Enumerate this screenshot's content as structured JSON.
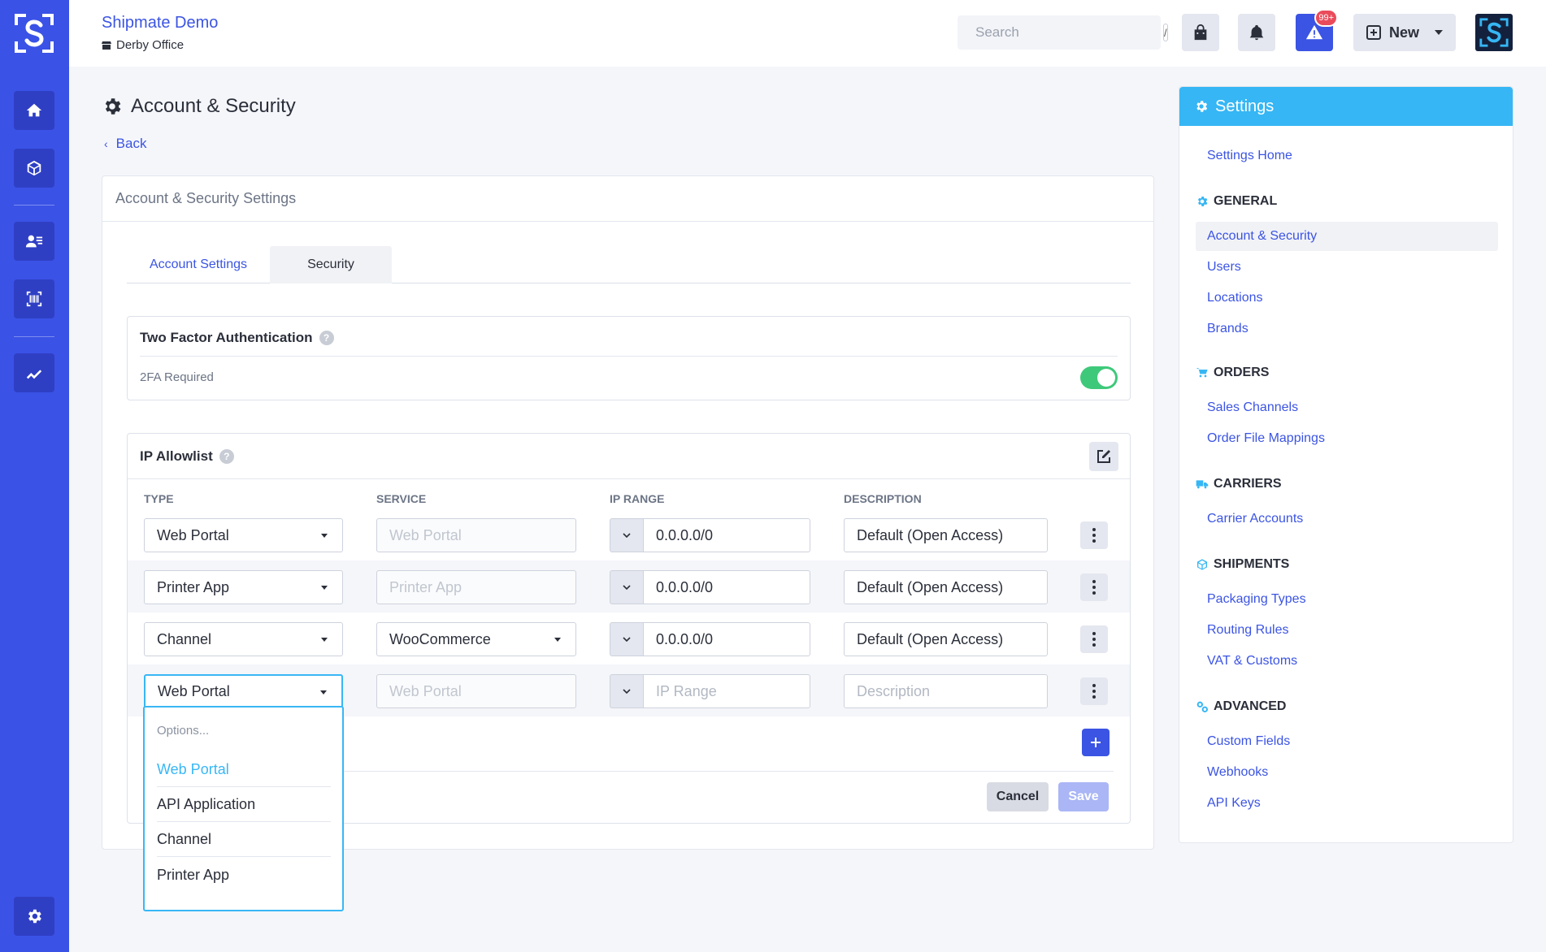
{
  "colors": {
    "brand": "#3a52e6",
    "accent": "#36b6f4",
    "toggle_on": "#3ec97a"
  },
  "sidebar": {
    "logo_icon": "shipmate-logo-icon",
    "items": [
      {
        "icon": "home-icon"
      },
      {
        "icon": "package-icon"
      },
      {
        "icon": "contacts-icon"
      },
      {
        "icon": "barcode-icon"
      },
      {
        "icon": "chart-line-icon"
      }
    ],
    "footer_icon": "gear-icon"
  },
  "topbar": {
    "org_name": "Shipmate Demo",
    "location": "Derby Office",
    "search_placeholder": "Search",
    "search_shortcut": "/",
    "alert_badge": "99+",
    "new_label": "New"
  },
  "page": {
    "title": "Account & Security",
    "back_label": "Back"
  },
  "card": {
    "header": "Account & Security Settings",
    "tabs": [
      {
        "label": "Account Settings"
      },
      {
        "label": "Security"
      }
    ],
    "two_factor": {
      "title": "Two Factor Authentication",
      "row_label": "2FA Required",
      "enabled": true
    },
    "ip_allowlist": {
      "title": "IP Allowlist",
      "columns": [
        "TYPE",
        "SERVICE",
        "IP RANGE",
        "DESCRIPTION"
      ],
      "rows": [
        {
          "type": "Web Portal",
          "service": "Web Portal",
          "ip_range": "0.0.0.0/0",
          "description": "Default (Open Access)"
        },
        {
          "type": "Printer App",
          "service": "Printer App",
          "ip_range": "0.0.0.0/0",
          "description": "Default (Open Access)"
        },
        {
          "type": "Channel",
          "service": "WooCommerce",
          "ip_range": "0.0.0.0/0",
          "description": "Default (Open Access)"
        },
        {
          "type": "Web Portal",
          "service": "Web Portal",
          "ip_range_placeholder": "IP Range",
          "description_placeholder": "Description"
        }
      ],
      "cancel_label": "Cancel",
      "save_label": "Save"
    },
    "dropdown": {
      "placeholder": "Options...",
      "options": [
        "Web Portal",
        "API Application",
        "Channel",
        "Printer App"
      ],
      "selected": "Web Portal"
    }
  },
  "settings_nav": {
    "title": "Settings",
    "home": "Settings Home",
    "sections": [
      {
        "heading": "GENERAL",
        "icon": "gear-icon",
        "items": [
          "Account & Security",
          "Users",
          "Locations",
          "Brands"
        ]
      },
      {
        "heading": "ORDERS",
        "icon": "cart-icon",
        "items": [
          "Sales Channels",
          "Order File Mappings"
        ]
      },
      {
        "heading": "CARRIERS",
        "icon": "truck-icon",
        "items": [
          "Carrier Accounts"
        ]
      },
      {
        "heading": "SHIPMENTS",
        "icon": "box-icon",
        "items": [
          "Packaging Types",
          "Routing Rules",
          "VAT & Customs"
        ]
      },
      {
        "heading": "ADVANCED",
        "icon": "gears-icon",
        "items": [
          "Custom Fields",
          "Webhooks",
          "API Keys"
        ]
      }
    ]
  }
}
